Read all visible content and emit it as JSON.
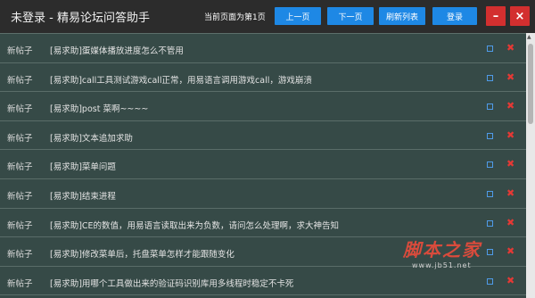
{
  "window": {
    "title": "未登录 - 精易论坛问答助手",
    "page_indicator": "当前页面为第1页",
    "minimize_label": "–",
    "close_label": "×"
  },
  "toolbar": {
    "prev_label": "上一页",
    "next_label": "下一页",
    "refresh_label": "刷新列表",
    "login_label": "登录"
  },
  "posts": [
    {
      "tag": "新帖子",
      "subject": "[易求助]蛋媒体播放进度怎么不管用"
    },
    {
      "tag": "新帖子",
      "subject": "[易求助]call工具测试游戏call正常，用易语言调用游戏call，游戏崩溃"
    },
    {
      "tag": "新帖子",
      "subject": "[易求助]post 菜啊~~~~"
    },
    {
      "tag": "新帖子",
      "subject": "[易求助]文本追加求助"
    },
    {
      "tag": "新帖子",
      "subject": "[易求助]菜单问题"
    },
    {
      "tag": "新帖子",
      "subject": "[易求助]结束进程"
    },
    {
      "tag": "新帖子",
      "subject": "[易求助]CE的数值，用易语言读取出来为负数，请问怎么处理啊，求大神告知"
    },
    {
      "tag": "新帖子",
      "subject": "[易求助]修改菜单后，托盘菜单怎样才能跟随变化"
    },
    {
      "tag": "新帖子",
      "subject": "[易求助]用哪个工具做出来的验证码识别库用多线程时稳定不卡死"
    }
  ],
  "watermark": {
    "logo_text": "脚本之家",
    "url": "www.jb51.net"
  },
  "icons": {
    "open": "open-square-icon",
    "delete": "delete-x-icon"
  },
  "colors": {
    "titlebar": "#2c2c2c",
    "list_bg": "#364a47",
    "button": "#1e88e5",
    "window_controls": "#d32f2f",
    "delete": "#e53935"
  }
}
